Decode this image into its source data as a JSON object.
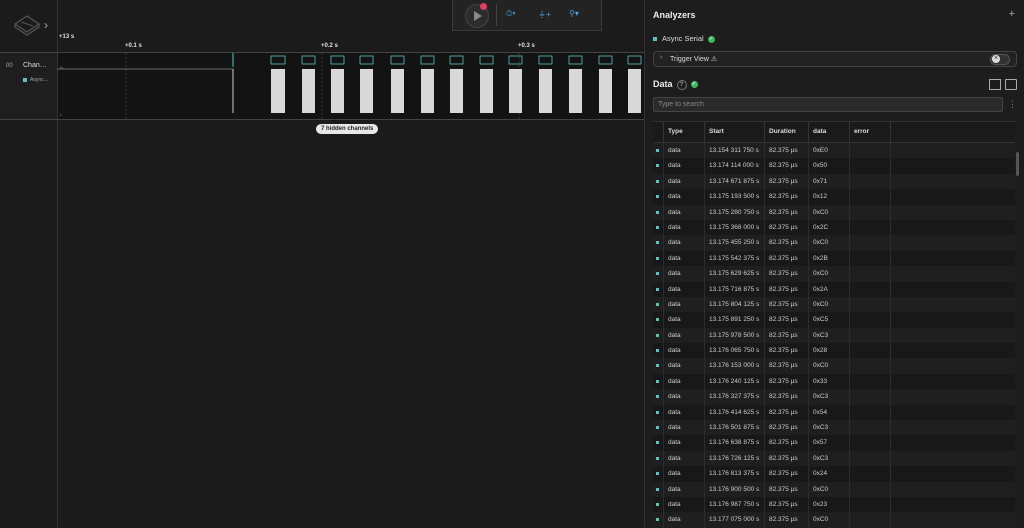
{
  "timeline": {
    "labels": [
      "+13 s",
      "+0.1 s",
      "+0.2 s",
      "+0.3 s"
    ]
  },
  "channel": {
    "number": "00",
    "name": "Chan…",
    "analyzer_label": "Async…"
  },
  "hidden_channels": "7 hidden channels",
  "analyzers": {
    "title": "Analyzers",
    "add": "+",
    "items": [
      {
        "name": "Async Serial"
      }
    ],
    "trigger_view": "Trigger View ⚠"
  },
  "data_panel": {
    "title": "Data",
    "search_placeholder": "Type to search",
    "columns": [
      "Type",
      "Start",
      "Duration",
      "data",
      "error"
    ],
    "rows": [
      {
        "type": "data",
        "start": "13.154 311 750 s",
        "duration": "82.375 µs",
        "data": "0xE0",
        "error": ""
      },
      {
        "type": "data",
        "start": "13.174 114 000 s",
        "duration": "82.375 µs",
        "data": "0x50",
        "error": ""
      },
      {
        "type": "data",
        "start": "13.174 671 875 s",
        "duration": "82.375 µs",
        "data": "0x71",
        "error": ""
      },
      {
        "type": "data",
        "start": "13.175 193 500 s",
        "duration": "82.375 µs",
        "data": "0x12",
        "error": ""
      },
      {
        "type": "data",
        "start": "13.175 280 750 s",
        "duration": "82.375 µs",
        "data": "0xC0",
        "error": ""
      },
      {
        "type": "data",
        "start": "13.175 368 000 s",
        "duration": "82.375 µs",
        "data": "0x2C",
        "error": ""
      },
      {
        "type": "data",
        "start": "13.175 455 250 s",
        "duration": "82.375 µs",
        "data": "0xC0",
        "error": ""
      },
      {
        "type": "data",
        "start": "13.175 542 375 s",
        "duration": "82.375 µs",
        "data": "0x2B",
        "error": ""
      },
      {
        "type": "data",
        "start": "13.175 629 625 s",
        "duration": "82.375 µs",
        "data": "0xC0",
        "error": ""
      },
      {
        "type": "data",
        "start": "13.175 716 875 s",
        "duration": "82.375 µs",
        "data": "0x2A",
        "error": ""
      },
      {
        "type": "data",
        "start": "13.175 804 125 s",
        "duration": "82.375 µs",
        "data": "0xC0",
        "error": ""
      },
      {
        "type": "data",
        "start": "13.175 891 250 s",
        "duration": "82.375 µs",
        "data": "0xC5",
        "error": ""
      },
      {
        "type": "data",
        "start": "13.175 978 500 s",
        "duration": "82.375 µs",
        "data": "0xC3",
        "error": ""
      },
      {
        "type": "data",
        "start": "13.176 065 750 s",
        "duration": "82.375 µs",
        "data": "0x28",
        "error": ""
      },
      {
        "type": "data",
        "start": "13.176 153 000 s",
        "duration": "82.375 µs",
        "data": "0xC0",
        "error": ""
      },
      {
        "type": "data",
        "start": "13.176 240 125 s",
        "duration": "82.375 µs",
        "data": "0x33",
        "error": ""
      },
      {
        "type": "data",
        "start": "13.176 327 375 s",
        "duration": "82.375 µs",
        "data": "0xC3",
        "error": ""
      },
      {
        "type": "data",
        "start": "13.176 414 625 s",
        "duration": "82.375 µs",
        "data": "0x54",
        "error": ""
      },
      {
        "type": "data",
        "start": "13.176 501 875 s",
        "duration": "82.375 µs",
        "data": "0xC3",
        "error": ""
      },
      {
        "type": "data",
        "start": "13.176 638 875 s",
        "duration": "82.375 µs",
        "data": "0x57",
        "error": ""
      },
      {
        "type": "data",
        "start": "13.176 726 125 s",
        "duration": "82.375 µs",
        "data": "0xC3",
        "error": ""
      },
      {
        "type": "data",
        "start": "13.176 813 375 s",
        "duration": "82.375 µs",
        "data": "0x24",
        "error": ""
      },
      {
        "type": "data",
        "start": "13.176 900 500 s",
        "duration": "82.375 µs",
        "data": "0xC0",
        "error": ""
      },
      {
        "type": "data",
        "start": "13.176 987 750 s",
        "duration": "82.375 µs",
        "data": "0x23",
        "error": ""
      },
      {
        "type": "data",
        "start": "13.177 075 000 s",
        "duration": "82.375 µs",
        "data": "0xC0",
        "error": ""
      }
    ]
  },
  "colors": {
    "accent": "#5cc4c0",
    "ok": "#3db85a",
    "record": "#e04060",
    "toolbar_icon": "#4aa3e0"
  }
}
